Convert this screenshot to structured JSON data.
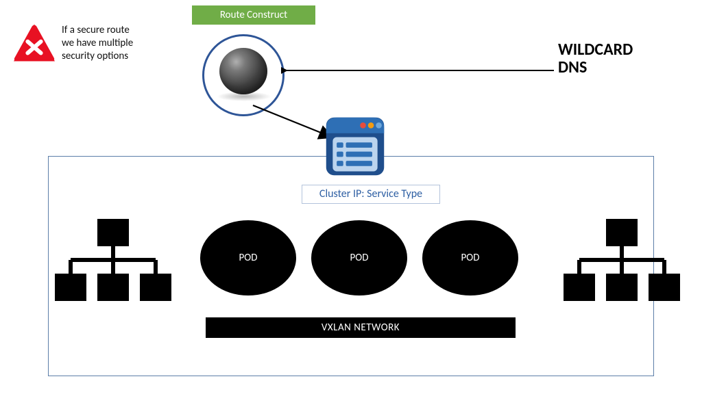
{
  "route_banner": "Route Construct",
  "warn_text_l1": "If a secure route",
  "warn_text_l2": "we have multiple",
  "warn_text_l3": "security options",
  "dns_l1": "WILDCARD",
  "dns_l2": "DNS",
  "svc_label": "Cluster IP: Service Type",
  "pod_label": "POD",
  "vxlan_label": "VXLAN NETWORK"
}
